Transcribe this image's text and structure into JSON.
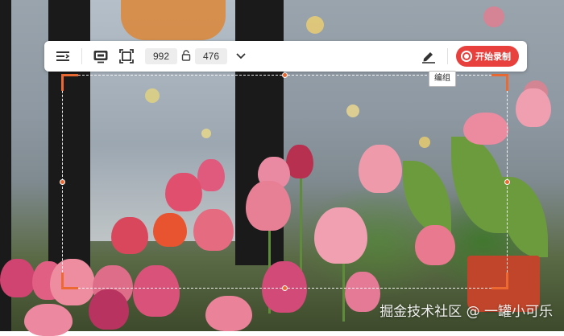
{
  "toolbar": {
    "width_value": "992",
    "height_value": "476",
    "record_label": "开始录制",
    "accent_color": "#ec6a32",
    "record_color": "#e8403c",
    "icons": [
      "list-icon",
      "screen-capture-icon",
      "fullscreen-select-icon",
      "lock-icon",
      "chevron-down-icon",
      "edit-icon",
      "record-icon"
    ]
  },
  "tooltip": {
    "text": "编组"
  },
  "watermark": {
    "text": "掘金技术社区 @ 一罐小可乐"
  }
}
